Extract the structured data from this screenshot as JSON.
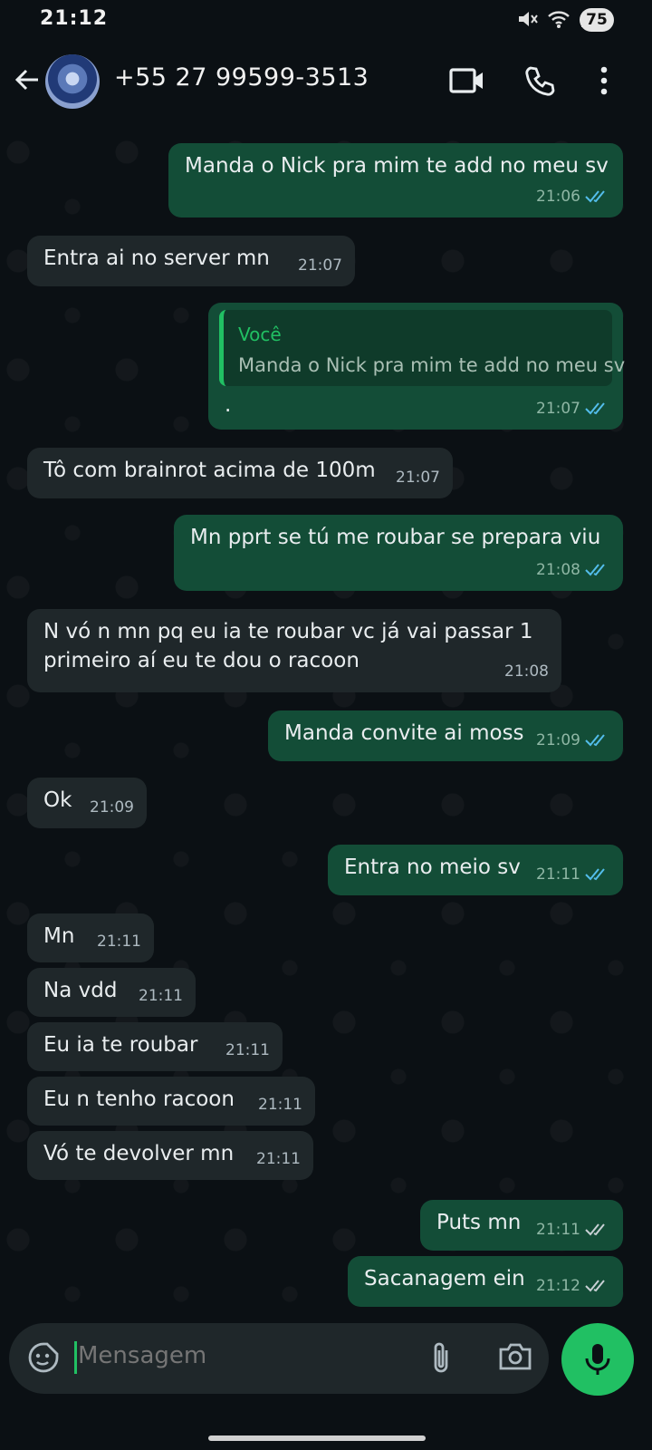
{
  "status_bar": {
    "time": "21:12",
    "battery": "75"
  },
  "header": {
    "contact": "+55 27 99599-3513"
  },
  "messages": [
    {
      "dir": "out",
      "text": "Manda o Nick pra mim te add no meu sv",
      "time": "21:06",
      "read": true
    },
    {
      "dir": "in",
      "text": "Entra ai no server mn",
      "time": "21:07"
    },
    {
      "dir": "out",
      "quote_author": "Você",
      "quote_text": "Manda o Nick pra mim te add no meu sv",
      "text": ".",
      "time": "21:07",
      "read": true
    },
    {
      "dir": "in",
      "text": "Tô com brainrot acima de 100m",
      "time": "21:07"
    },
    {
      "dir": "out",
      "text": "Mn pprt se tú me roubar se prepara viu",
      "time": "21:08",
      "read": true
    },
    {
      "dir": "in",
      "text_line1": "N vó n mn pq eu ia te roubar vc já vai passar 1",
      "text_line2": "primeiro aí eu te dou o racoon",
      "time": "21:08"
    },
    {
      "dir": "out",
      "text": "Manda convite ai moss",
      "time": "21:09",
      "read": true
    },
    {
      "dir": "in",
      "text": "Ok",
      "time": "21:09"
    },
    {
      "dir": "out",
      "text": "Entra no meio sv",
      "time": "21:11",
      "read": true
    },
    {
      "dir": "in",
      "text": "Mn",
      "time": "21:11"
    },
    {
      "dir": "in",
      "text": "Na vdd",
      "time": "21:11"
    },
    {
      "dir": "in",
      "text": "Eu ia te roubar",
      "time": "21:11"
    },
    {
      "dir": "in",
      "text": "Eu n tenho racoon",
      "time": "21:11"
    },
    {
      "dir": "in",
      "text": "Vó te devolver mn",
      "time": "21:11"
    },
    {
      "dir": "out",
      "text": "Puts mn",
      "time": "21:11",
      "read": false
    },
    {
      "dir": "out",
      "text": "Sacanagem ein",
      "time": "21:12",
      "read": false
    }
  ],
  "input": {
    "placeholder": "Mensagem"
  },
  "icons": {
    "back": "arrow-left-icon",
    "video": "video-call-icon",
    "phone": "phone-icon",
    "menu": "more-vert-icon",
    "emoji": "sticker-icon",
    "attach": "paperclip-icon",
    "camera": "camera-icon",
    "mic": "mic-icon"
  },
  "colors": {
    "accent": "#21c063",
    "outgoing": "#134d37",
    "incoming": "#1f272a",
    "read_ticks": "#53bdeb",
    "sent_ticks": "#aebac1"
  }
}
